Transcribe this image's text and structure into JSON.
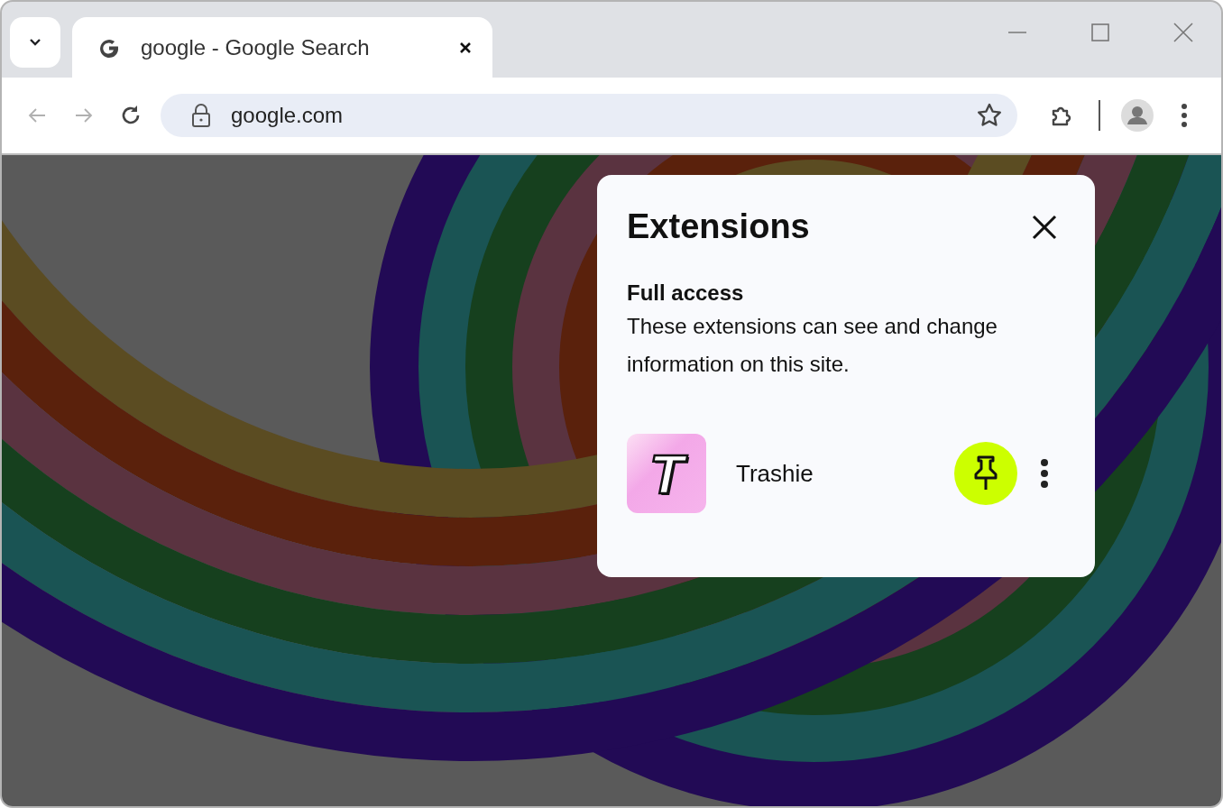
{
  "tabs": [
    {
      "title": "google - Google Search",
      "selected": true
    }
  ],
  "navigation": {
    "back_disabled": true,
    "forward_disabled": true
  },
  "address_bar": {
    "url": "google.com"
  },
  "popup": {
    "title": "Extensions",
    "section_title": "Full access",
    "description": "These extensions can see and change information on this site.",
    "extensions": [
      {
        "name": "Trashie",
        "logo_letter": "T",
        "pinned": true
      }
    ]
  }
}
